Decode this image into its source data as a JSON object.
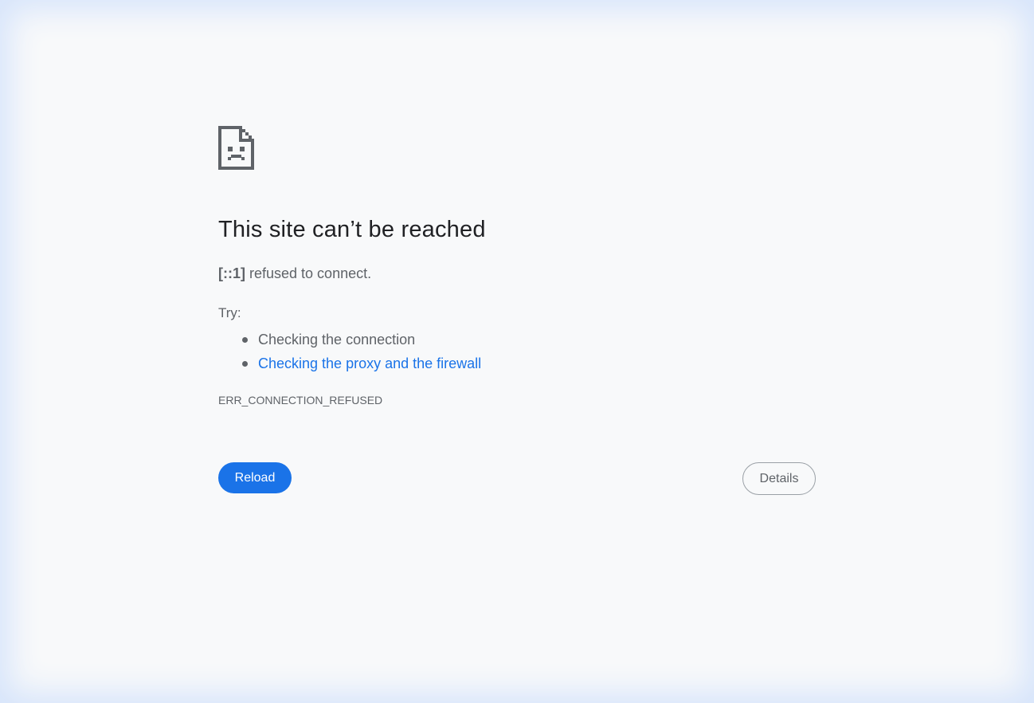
{
  "error_page": {
    "icon": "sad-page-icon",
    "title": "This site can’t be reached",
    "summary_host": "[::1]",
    "summary_text": " refused to connect.",
    "try_label": "Try:",
    "suggestions": [
      {
        "label": "Checking the connection",
        "is_link": false
      },
      {
        "label": "Checking the proxy and the firewall",
        "is_link": true
      }
    ],
    "error_code": "ERR_CONNECTION_REFUSED",
    "reload_label": "Reload",
    "details_label": "Details"
  },
  "colors": {
    "background": "#f8f9fa",
    "accent": "#1a73e8",
    "text": "#5f6368",
    "heading": "#202124"
  }
}
